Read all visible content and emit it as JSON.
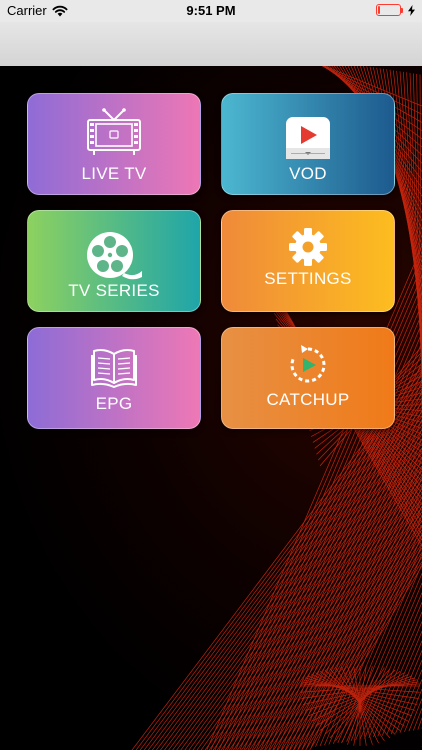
{
  "status_bar": {
    "carrier": "Carrier",
    "time": "9:51 PM",
    "wifi_icon": "wifi-icon",
    "battery_level": 0.1,
    "battery_color": "#ff3b30",
    "charging_icon": "bolt-icon"
  },
  "menu": {
    "live_tv": {
      "label": "LIVE TV",
      "icon": "tv-antenna-icon"
    },
    "vod": {
      "label": "VOD",
      "icon": "play-screen-icon"
    },
    "tv_series": {
      "label": "TV SERIES",
      "icon": "film-reel-icon"
    },
    "settings": {
      "label": "SETTINGS",
      "icon": "gear-icon"
    },
    "epg": {
      "label": "EPG",
      "icon": "open-book-icon"
    },
    "catchup": {
      "label": "CATCHUP",
      "icon": "replay-icon"
    }
  },
  "colors": {
    "accent_red": "#ff3b30",
    "background_lines": "#e02a10"
  }
}
